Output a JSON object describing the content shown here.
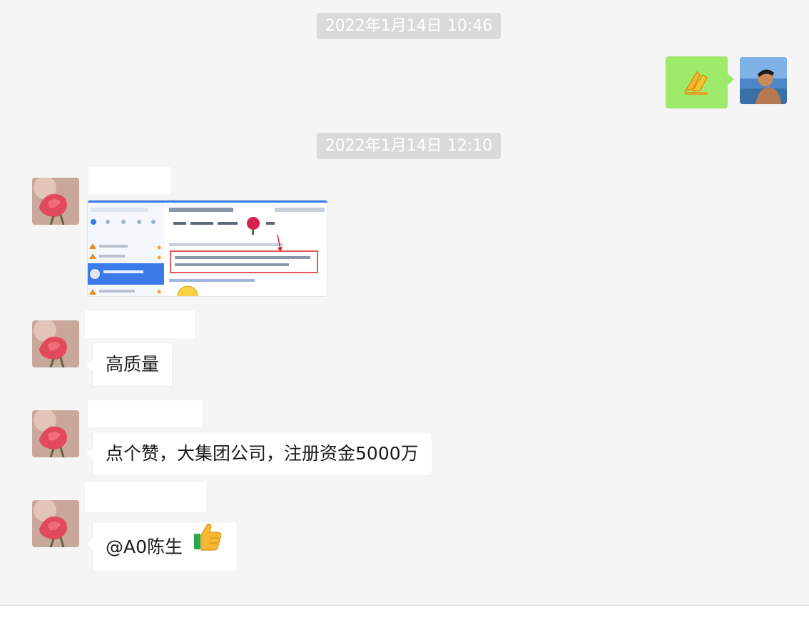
{
  "timestamps": [
    "2022年1月14日 10:46",
    "2022年1月14日 12:10"
  ],
  "messages": {
    "m1_text": "高质量",
    "m2_text": "点个赞，大集团公司，注册资金5000万",
    "m3_text": "@A0陈生"
  },
  "icons": {
    "sent_emoji": "folded-hands-icon",
    "thumbs": "thumbs-up-icon"
  },
  "colors": {
    "background": "#f5f5f5",
    "sent_bubble": "#9eea6a",
    "received_bubble": "#ffffff",
    "timestamp_bg": "#dadada"
  }
}
